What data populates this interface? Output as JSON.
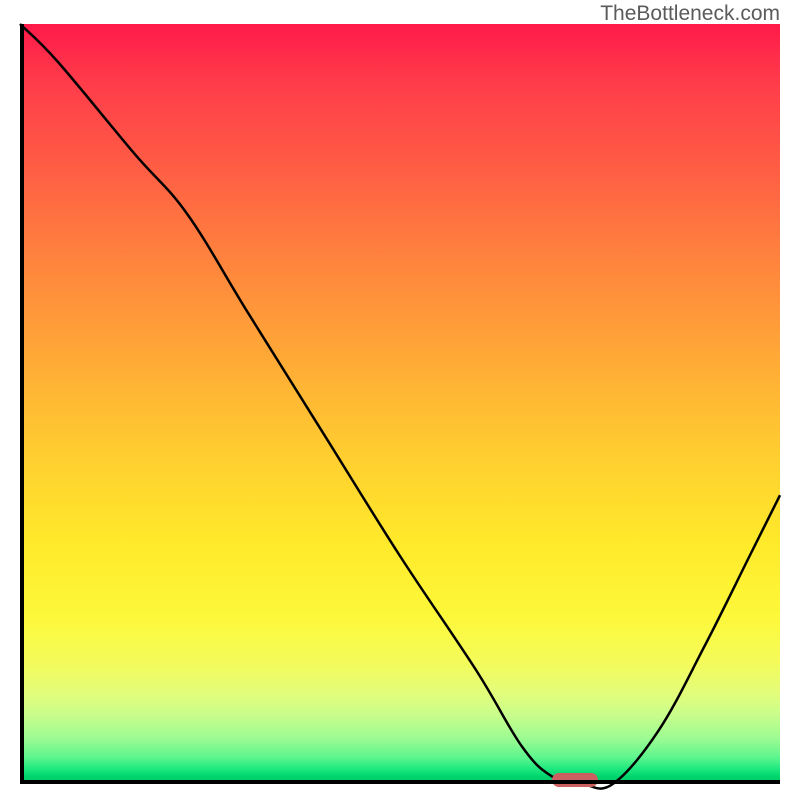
{
  "watermark": "TheBottleneck.com",
  "chart_data": {
    "type": "line",
    "title": "",
    "xlabel": "",
    "ylabel": "",
    "x_range": [
      0,
      100
    ],
    "y_range": [
      0,
      100
    ],
    "series": [
      {
        "name": "curve",
        "x": [
          0,
          5,
          15,
          22,
          30,
          40,
          50,
          60,
          66,
          70,
          74,
          78,
          84,
          90,
          96,
          100
        ],
        "y": [
          100,
          95,
          83,
          75,
          62,
          46,
          30,
          15,
          5,
          1,
          0,
          0,
          7,
          18,
          30,
          38
        ]
      }
    ],
    "marker": {
      "x_start": 70,
      "x_end": 76,
      "y": 0.5
    },
    "gradient_stops": [
      {
        "pos": 0.0,
        "color": "#ff1a4a"
      },
      {
        "pos": 0.5,
        "color": "#ffd12f"
      },
      {
        "pos": 0.85,
        "color": "#f4fb5a"
      },
      {
        "pos": 1.0,
        "color": "#00c764"
      }
    ]
  }
}
